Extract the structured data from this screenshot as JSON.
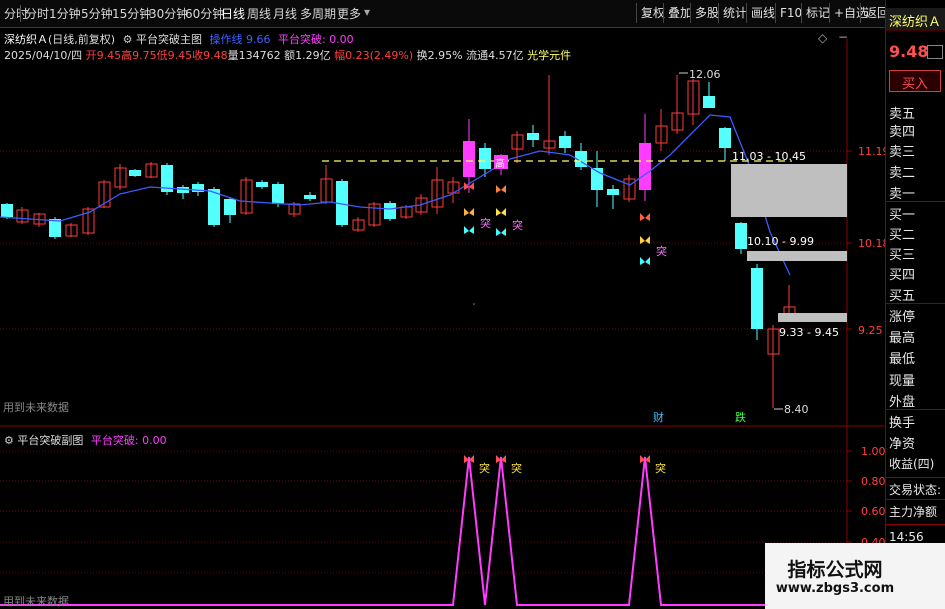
{
  "toolbar": {
    "periods": [
      "分时",
      "1分钟",
      "5分钟",
      "15分钟",
      "30分钟",
      "60分钟",
      "日线",
      "周线",
      "月线",
      "多周期",
      "更多"
    ],
    "active_index": 6,
    "right_buttons": [
      "复权",
      "叠加",
      "多股",
      "统计",
      "画线",
      "F10",
      "标记",
      "+自选",
      "返回"
    ]
  },
  "header": {
    "stock_name": "深纺织Ａ",
    "period_info": "(日线,前复权)",
    "indicator_name": "平台突破主图",
    "trigger_label": "操作线",
    "trigger_value": "9.66",
    "breakout_label": "平台突破:",
    "breakout_value": "0.00"
  },
  "quote": {
    "date": "2025/04/10/四",
    "open_label": "开",
    "open": "9.45",
    "high_label": "高",
    "high": "9.75",
    "low_label": "低",
    "low": "9.45",
    "close_label": "收",
    "close": "9.48",
    "volume_label": "量",
    "volume": "134762",
    "amount_label": "额",
    "amount": "1.29亿",
    "change_label": "幅",
    "change": "0.23(2.49%)",
    "turnover_label": "换",
    "turnover": "2.95%",
    "float_label": "流通",
    "float_value": "4.57亿",
    "concept": "光学元件"
  },
  "main_chart": {
    "y_ticks": [
      "11.19",
      "10.18",
      "9.25"
    ],
    "annotations": {
      "high_price": "12.06",
      "low_price": "8.40",
      "zone_upper": "11.03 - 10.45",
      "zone_middle": "10.10 - 9.99",
      "zone_lower": "9.33 - 9.45",
      "signal_char": "突",
      "marker_cai": "财",
      "marker_die": "跌",
      "marker_gao": "高"
    },
    "future_data_label": "用到未来数据",
    "diamond": "◇",
    "minus": "−",
    "colors": {
      "up": "#ff3c3c",
      "down": "#54ffff",
      "ma": "#3a5cff",
      "magenta": "#ff3cff",
      "zone": "#bfbfbf",
      "dash": "#ffff66"
    }
  },
  "sub_chart": {
    "title": "平台突破副图",
    "value_label": "平台突破:",
    "value": "0.00",
    "y_ticks": [
      "1.00",
      "0.80",
      "0.60",
      "0.40",
      "0.20"
    ],
    "signal_char": "突",
    "future_data_label": "用到未来数据"
  },
  "side_panel": {
    "name": "深纺织Ａ",
    "price": "9.48",
    "buy_button": "买入",
    "rows": [
      "卖五",
      "卖四",
      "卖三",
      "卖二",
      "卖一",
      "买一",
      "买二",
      "买三",
      "买四",
      "买五",
      "涨停",
      "最高",
      "最低",
      "现量",
      "外盘",
      "换手",
      "净资",
      "收益(四)",
      "交易状态:",
      "主力净额"
    ],
    "time": "14:56"
  },
  "watermark": {
    "title": "指标公式网",
    "url": "www.zbgs3.com"
  },
  "chart_data": {
    "type": "candlestick",
    "title": "平台突破主图",
    "y_ticks_main": [
      11.19,
      10.18,
      9.25
    ],
    "y_ticks_sub": [
      1.0,
      0.8,
      0.6,
      0.4,
      0.2
    ],
    "marked_high": 12.06,
    "marked_low": 8.4,
    "zones": [
      {
        "label": "11.03 - 10.45",
        "upper": 11.03,
        "lower": 10.45
      },
      {
        "label": "10.10 - 9.99",
        "upper": 10.1,
        "lower": 9.99
      },
      {
        "label": "9.33 - 9.45",
        "upper": 9.45,
        "lower": 9.33
      }
    ],
    "subchart_signal": [
      0,
      0,
      0,
      0,
      0,
      0,
      0,
      0,
      0,
      0,
      0,
      0,
      0,
      0,
      0,
      0,
      0,
      0,
      0,
      0,
      0,
      0,
      0,
      0,
      0,
      0,
      0,
      0,
      0,
      1,
      0,
      1,
      0,
      0,
      0,
      0,
      0,
      0,
      0,
      0,
      1,
      0,
      0,
      0,
      0,
      0,
      0,
      0,
      0,
      0
    ]
  }
}
